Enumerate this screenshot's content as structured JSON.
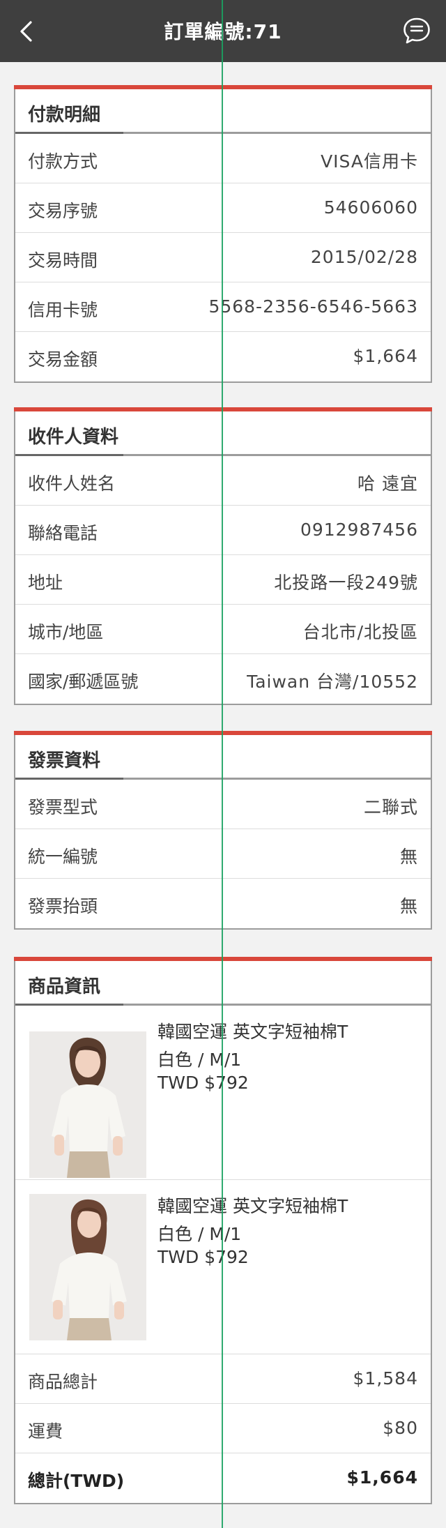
{
  "header": {
    "title": "訂單編號:71"
  },
  "payment": {
    "title": "付款明細",
    "rows": [
      {
        "label": "付款方式",
        "value": "VISA信用卡"
      },
      {
        "label": "交易序號",
        "value": "54606060"
      },
      {
        "label": "交易時間",
        "value": "2015/02/28"
      },
      {
        "label": "信用卡號",
        "value": "5568-2356-6546-5663"
      },
      {
        "label": "交易金額",
        "value": "$1,664"
      }
    ]
  },
  "recipient": {
    "title": "收件人資料",
    "rows": [
      {
        "label": "收件人姓名",
        "value": "哈 遠宜"
      },
      {
        "label": "聯絡電話",
        "value": "0912987456"
      },
      {
        "label": "地址",
        "value": "北投路一段249號"
      },
      {
        "label": "城市/地區",
        "value": "台北市/北投區"
      },
      {
        "label": "國家/郵遞區號",
        "value": "Taiwan 台灣/10552"
      }
    ]
  },
  "invoice": {
    "title": "發票資料",
    "rows": [
      {
        "label": "發票型式",
        "value": "二聯式"
      },
      {
        "label": "統一編號",
        "value": "無"
      },
      {
        "label": "發票抬頭",
        "value": "無"
      }
    ]
  },
  "products": {
    "title": "商品資訊",
    "items": [
      {
        "name": "韓國空運 英文字短袖棉T",
        "spec": "白色 / M/1",
        "price": "TWD $792"
      },
      {
        "name": "韓國空運 英文字短袖棉T",
        "spec": "白色 / M/1",
        "price": "TWD $792"
      }
    ],
    "summary": [
      {
        "label": "商品總計",
        "value": "$1,584"
      },
      {
        "label": "運費",
        "value": "$80"
      },
      {
        "label": "總計(TWD)",
        "value": "$1,664"
      }
    ]
  },
  "colors": {
    "header_bg": "#3f3f3f",
    "accent_bar": "#d9473b",
    "guide_line": "#1aa260"
  }
}
